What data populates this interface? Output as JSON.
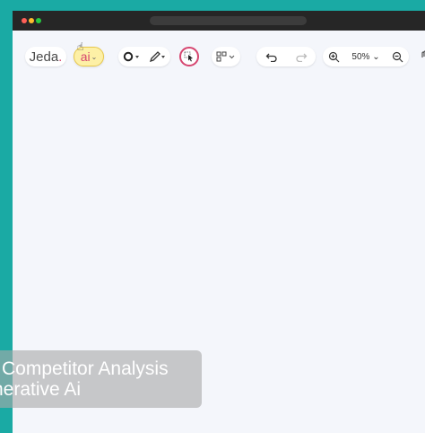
{
  "toolbar": {
    "logo_text": "Jeda",
    "logo_accent": ".",
    "ai_label": "ai",
    "zoom_level": "50%"
  },
  "caption": {
    "line1": "Competitor Analysis",
    "line2": "nerative Ai"
  },
  "colors": {
    "accent": "#d6456f",
    "ai_highlight": "#fdf0a6",
    "frame": "#1aaaa4",
    "canvas": "#f4f6fb"
  }
}
